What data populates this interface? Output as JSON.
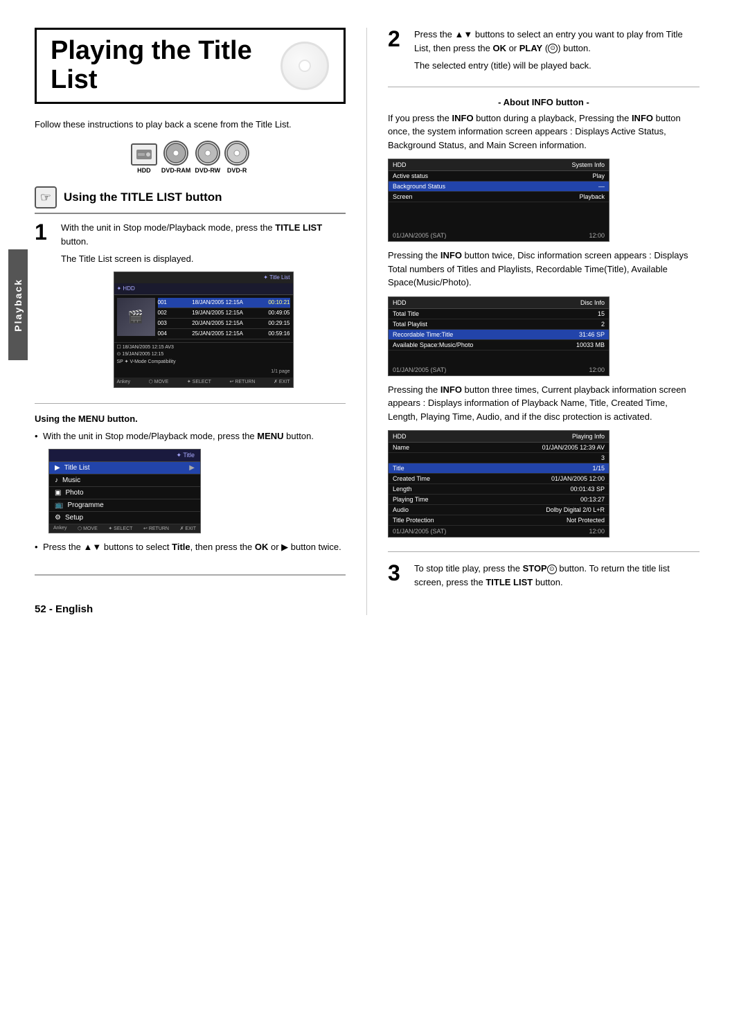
{
  "page": {
    "title": "Playing the Title List",
    "page_number": "52 - English",
    "sidebar_label": "Playback"
  },
  "intro": {
    "text": "Follow these instructions to play back a scene from the Title List."
  },
  "devices": [
    {
      "label": "HDD"
    },
    {
      "label": "DVD-RAM"
    },
    {
      "label": "DVD-RW"
    },
    {
      "label": "DVD-R"
    }
  ],
  "section1": {
    "heading": "Using the TITLE LIST button"
  },
  "step1": {
    "number": "1",
    "text": "With the unit in Stop mode/Playback mode, press the ",
    "bold": "TITLE LIST",
    "text2": " button.",
    "sub": "The Title List screen is displayed."
  },
  "title_list_screen": {
    "header": "✦ Title List",
    "hdd_label": "✦ HDD",
    "rows": [
      {
        "num": "001",
        "date": "18/JAN/2005 12:15A",
        "time": "00:10:21"
      },
      {
        "num": "002",
        "date": "19/JAN/2005 12:15A",
        "time": "00:49:05"
      },
      {
        "num": "003",
        "date": "20/JAN/2005 12:15A",
        "time": "00:29:15"
      },
      {
        "num": "004",
        "date": "25/JAN/2005 12:15A",
        "time": "00:59:16"
      }
    ],
    "info1": "18/JAN/2005 12:15 AV3",
    "info2": "19/JAN/2005 12:15",
    "info3": "SP  ✦ V-Mode Compatibility",
    "page": "1/1 page",
    "nav": "Ankey  ✦ MOVE  ✦ SELECT  ✦ RETURN  ✦ EXIT"
  },
  "using_menu": {
    "heading": "Using the MENU button.",
    "bullet1": "With the unit in Stop mode/Playback mode, press the ",
    "bullet1_bold": "MENU",
    "bullet1_2": " button.",
    "menu_screen": {
      "header": "✦ Title",
      "items": [
        {
          "icon": "▶",
          "label": "Title List",
          "arrow": "▶",
          "active": true
        },
        {
          "icon": "♪",
          "label": "Music",
          "arrow": "",
          "active": false
        },
        {
          "icon": "▣",
          "label": "Photo",
          "arrow": "",
          "active": false
        },
        {
          "icon": "📺",
          "label": "Programme",
          "arrow": "",
          "active": false
        },
        {
          "icon": "⚙",
          "label": "Setup",
          "arrow": "",
          "active": false
        }
      ],
      "nav": "Ankey  ✦ MOVE  ✦ SELECT  ✦ RETURN  ✦ EXIT"
    },
    "bullet2_pre": "Press the ▲▼ buttons to select ",
    "bullet2_bold": "Title",
    "bullet2_post": ", then press the ",
    "bullet2_bold2": "OK",
    "bullet2_end": " or ▶ button twice."
  },
  "step2": {
    "number": "2",
    "text": "Press the ▲▼ buttons to select an entry you want to play from Title List, then press the ",
    "bold": "OK",
    "text2": " or ",
    "bold2": "PLAY",
    "text3": " (⊙) button.",
    "sub": "The selected entry (title) will be played back."
  },
  "about_info": {
    "heading": "- About INFO button -",
    "para1": "If you press the ",
    "para1_bold": "INFO",
    "para1_2": " button during a playback, Pressing the ",
    "para1_bold2": "INFO",
    "para1_3": " button once, the system information screen appears : Displays Active Status, Background Status, and Main Screen information.",
    "system_info_screen": {
      "header_left": "HDD",
      "header_right": "System Info",
      "rows": [
        {
          "label": "Active status",
          "value": "Play"
        },
        {
          "label": "Background Status",
          "value": "—"
        },
        {
          "label": "Screen",
          "value": "Playback"
        },
        {
          "label": "01/JAN/2005 (SAT)",
          "value": "12:00"
        }
      ]
    },
    "para2": "Pressing the ",
    "para2_bold": "INFO",
    "para2_2": " button twice, Disc information screen appears : Displays Total numbers of Titles and Playlists, Recordable Time(Title), Available Space(Music/Photo).",
    "disc_info_screen": {
      "header_left": "HDD",
      "header_right": "Disc Info",
      "rows": [
        {
          "label": "Total Title",
          "value": "15"
        },
        {
          "label": "Total Playlist",
          "value": "2"
        },
        {
          "label": "Recordable Time:Title",
          "value": "31:46 SP"
        },
        {
          "label": "Available Space:Music/Photo",
          "value": "10033 MB"
        },
        {
          "label": "01/JAN/2005 (SAT)",
          "value": "12:00"
        }
      ]
    },
    "para3": "Pressing the ",
    "para3_bold": "INFO",
    "para3_2": " button three times, Current playback information screen appears : Displays information of Playback Name, Title, Created Time, Length, Playing Time, Audio, and if the disc protection is activated.",
    "playing_info_screen": {
      "header_left": "HDD",
      "header_right": "Playing Info",
      "rows": [
        {
          "label": "Name",
          "value": "01/JAN/2005 12:39 AV"
        },
        {
          "label": "",
          "value": "3"
        },
        {
          "label": "Title",
          "value": "1/15"
        },
        {
          "label": "Created Time",
          "value": "01/JAN/2005 12:00"
        },
        {
          "label": "Length",
          "value": "00:01:43 SP"
        },
        {
          "label": "Playing Time",
          "value": "00:13:27"
        },
        {
          "label": "Audio",
          "value": "Dolby Digital 2/0 L+R"
        },
        {
          "label": "Title Protection",
          "value": "Not Protected"
        },
        {
          "label": "01/JAN/2005 (SAT)",
          "value": "12:00"
        }
      ]
    }
  },
  "step3": {
    "number": "3",
    "text": "To stop title play, press the ",
    "bold": "STOP",
    "text2": "(⊙) button. To return the title list screen, press the ",
    "bold2": "TITLE LIST",
    "text3": " button."
  }
}
